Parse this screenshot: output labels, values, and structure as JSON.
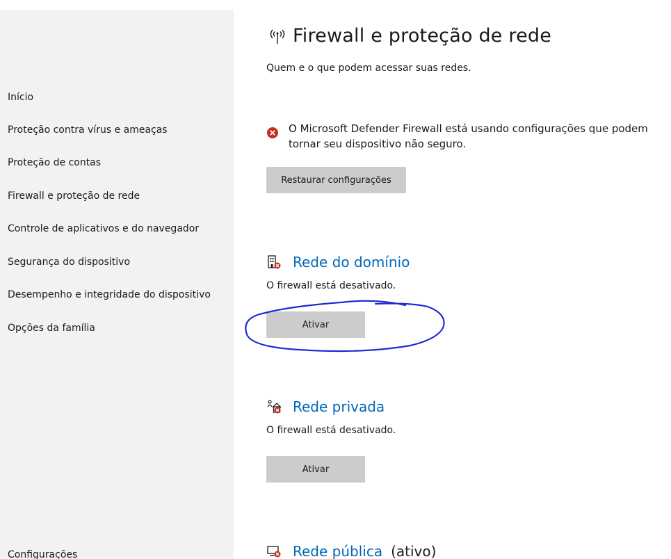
{
  "sidebar": {
    "items": [
      {
        "label": "Início"
      },
      {
        "label": "Proteção contra vírus e ameaças"
      },
      {
        "label": "Proteção de contas"
      },
      {
        "label": "Firewall e proteção de rede"
      },
      {
        "label": "Controle de aplicativos e do navegador"
      },
      {
        "label": "Segurança do dispositivo"
      },
      {
        "label": "Desempenho e integridade do dispositivo"
      },
      {
        "label": "Opções da família"
      }
    ],
    "settings_label": "Configurações"
  },
  "header": {
    "title": "Firewall e proteção de rede",
    "title_icon": "wireless-signal-icon",
    "subtitle": "Quem e o que podem acessar suas redes."
  },
  "warning": {
    "icon": "error-circle-icon",
    "text": "O Microsoft Defender Firewall está usando configurações que podem tornar seu dispositivo não seguro.",
    "button_label": "Restaurar configurações"
  },
  "networks": [
    {
      "name": "Rede do domínio",
      "icon": "domain-network-icon",
      "status": "O firewall está desativado.",
      "button_label": "Ativar",
      "active_label": ""
    },
    {
      "name": "Rede privada",
      "icon": "private-network-icon",
      "status": "O firewall está desativado.",
      "button_label": "Ativar",
      "active_label": ""
    },
    {
      "name": "Rede pública",
      "icon": "public-network-icon",
      "status": "",
      "button_label": "",
      "active_label": "(ativo)"
    }
  ],
  "colors": {
    "link": "#0067b8",
    "error": "#c42b1c",
    "button": "#cccccc",
    "sidebar_bg": "#f2f2f2",
    "annotation": "#1f2bd6"
  }
}
